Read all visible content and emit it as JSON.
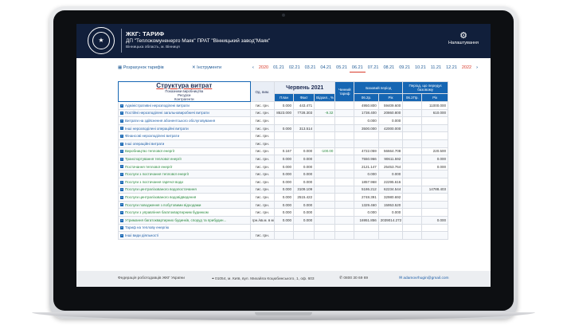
{
  "header": {
    "logo_text": "ФЕДЕРАЦІЯ РОБОТОДАВЦІВ",
    "app_title": "ЖКГ: ТАРИФ",
    "company": "ДП \"Теплокомуненерго Маяк\" ПРАТ \"Вінницький завод\"Маяк\"",
    "region": "Вінницька область, м. Вінниця",
    "settings_label": "Налаштування",
    "accent_color": "#111f3b"
  },
  "toolbar": {
    "tariff_calc": "Розрахунок тарифів",
    "tools": "Інструменти",
    "periods": [
      "2020",
      "01.21",
      "02.21",
      "03.21",
      "04.21",
      "05.21",
      "06.21",
      "07.21",
      "08.21",
      "09.21",
      "10.21",
      "11.21",
      "12.21",
      "2022"
    ],
    "selected_period": "06.21"
  },
  "table": {
    "title": "Структура витрат",
    "subtitle1": "Показники виробництва",
    "subtitle2": "Ресурси",
    "subtitle3": "Контрагенти",
    "col_unit": "Од. вим.",
    "month": "Червень 2021",
    "col_plan": "План",
    "col_fact": "Факт",
    "col_dev": "Відхил., %",
    "col_current": "Чинний тариф",
    "base_period": "Базовий період",
    "prev_base": "Період, що передує базовому",
    "col_06p": "06.2р.",
    "col_year": "Рік",
    "col_06p2": "06.2Пр.",
    "col_year2": "Рік",
    "rows": [
      {
        "name": "Адміністративні нерозподілені витрати",
        "unit": "тис. грн.",
        "plan": "0.000",
        "fact": "443.471",
        "dev": "",
        "cur": "",
        "b1": "4950.800",
        "b2": "59409.600",
        "p1": "",
        "p2": "11000.000",
        "green": false
      },
      {
        "name": "Постійні нерозподілені загальновиробничі витрати",
        "unit": "тис. грн.",
        "plan": "8523.000",
        "fact": "7728.303",
        "dev": "-9.32",
        "cur": "",
        "b1": "1738.400",
        "b2": "20860.800",
        "p1": "",
        "p2": "610.000",
        "green": false
      },
      {
        "name": "Витрати на здійснення абонентського обслуговування",
        "unit": "тис. грн.",
        "plan": "",
        "fact": "",
        "dev": "",
        "cur": "",
        "b1": "0.000",
        "b2": "0.000",
        "p1": "",
        "p2": "",
        "green": false
      },
      {
        "name": "Інші нерозподілені операційні витрати",
        "unit": "тис. грн.",
        "plan": "0.000",
        "fact": "313.514",
        "dev": "",
        "cur": "",
        "b1": "3500.000",
        "b2": "42000.000",
        "p1": "",
        "p2": "",
        "green": false
      },
      {
        "name": "Фінансові нерозподілені витрати",
        "unit": "тис. грн.",
        "plan": "",
        "fact": "",
        "dev": "",
        "cur": "",
        "b1": "",
        "b2": "",
        "p1": "",
        "p2": "",
        "green": false
      },
      {
        "name": "Інші операційні витрати",
        "unit": "тис. грн.",
        "plan": "",
        "fact": "",
        "dev": "",
        "cur": "",
        "b1": "",
        "b2": "",
        "p1": "",
        "p2": "",
        "green": false
      },
      {
        "name": "Виробництво теплової енергії",
        "unit": "тис. грн.",
        "plan": "0.167",
        "fact": "0.000",
        "dev": "-100.00",
        "cur": "",
        "b1": "4722.059",
        "b2": "56664.708",
        "p1": "",
        "p2": "220.500",
        "green": true
      },
      {
        "name": "Транспортування теплової енергії",
        "unit": "тис. грн.",
        "plan": "0.000",
        "fact": "0.000",
        "dev": "",
        "cur": "",
        "b1": "7550.966",
        "b2": "90611.592",
        "p1": "",
        "p2": "0.000",
        "green": true
      },
      {
        "name": "Постачання теплової енергії",
        "unit": "тис. грн.",
        "plan": "0.000",
        "fact": "0.000",
        "dev": "",
        "cur": "",
        "b1": "2121.147",
        "b2": "25453.764",
        "p1": "",
        "p2": "0.000",
        "green": true
      },
      {
        "name": "Послуги з постачання теплової енергії",
        "unit": "тис. грн.",
        "plan": "0.000",
        "fact": "0.000",
        "dev": "",
        "cur": "",
        "b1": "0.000",
        "b2": "0.000",
        "p1": "",
        "p2": "",
        "green": true
      },
      {
        "name": "Послуги з постачання гарячої води",
        "unit": "тис. грн.",
        "plan": "0.000",
        "fact": "0.000",
        "dev": "",
        "cur": "",
        "b1": "1857.968",
        "b2": "22295.616",
        "p1": "",
        "p2": "",
        "green": true
      },
      {
        "name": "Послуги централізованого водопостачання",
        "unit": "тис. грн.",
        "plan": "0.000",
        "fact": "3109.109",
        "dev": "",
        "cur": "",
        "b1": "5186.212",
        "b2": "62234.544",
        "p1": "",
        "p2": "14788.403",
        "green": true
      },
      {
        "name": "Послуги централізованого водовідведення",
        "unit": "тис. грн.",
        "plan": "0.000",
        "fact": "2515.422",
        "dev": "",
        "cur": "",
        "b1": "2748.391",
        "b2": "32980.692",
        "p1": "",
        "p2": "",
        "green": true
      },
      {
        "name": "Послуги поводження з побутовими відходами",
        "unit": "тис. грн.",
        "plan": "0.000",
        "fact": "0.000",
        "dev": "",
        "cur": "",
        "b1": "1329.460",
        "b2": "15953.520",
        "p1": "",
        "p2": "",
        "green": true
      },
      {
        "name": "Послуги з управління багатоквартирним будинком",
        "unit": "тис. грн.",
        "plan": "0.000",
        "fact": "0.000",
        "dev": "",
        "cur": "",
        "b1": "0.000",
        "b2": "0.000",
        "p1": "",
        "p2": "",
        "green": true
      },
      {
        "name": "Утримання багатоквартирних будинків, споруд та прибудин...",
        "unit": "грн./кв.м. в міс.",
        "plan": "0.000",
        "fact": "0.000",
        "dev": "",
        "cur": "",
        "b1": "16951.856",
        "b2": "2039014.272",
        "p1": "",
        "p2": "0.000",
        "green": true
      },
      {
        "name": "Тариф на теплову енергію",
        "unit": "",
        "plan": "",
        "fact": "",
        "dev": "",
        "cur": "",
        "b1": "",
        "b2": "",
        "p1": "",
        "p2": "",
        "green": false
      },
      {
        "name": "Інші види діяльності",
        "unit": "тис. грн.",
        "plan": "",
        "fact": "",
        "dev": "",
        "cur": "",
        "b1": "",
        "b2": "",
        "p1": "",
        "p2": "",
        "green": false
      }
    ]
  },
  "footer": {
    "org": "Федерація роботодавців ЖКГ України",
    "address": "01054, м. Київ, вул. Михайла Коцюбинського, 1, оф. 603",
    "phone": "0800 30 69 69",
    "email": "adamovrhugin@gmail.com"
  }
}
